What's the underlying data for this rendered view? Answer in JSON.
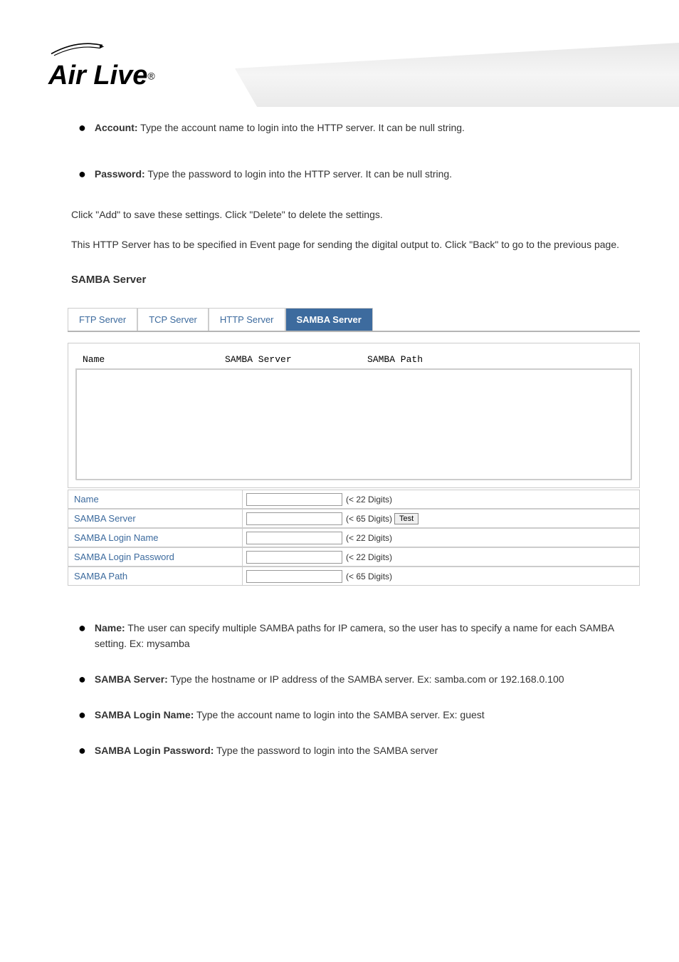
{
  "logo": {
    "brand": "Air Live",
    "registered": "®"
  },
  "top_bullets": [
    {
      "label": "Account:",
      "text": " Type the account name to login into the HTTP server. It can be null string."
    },
    {
      "label": "Password:",
      "text": " Type the password to login into the HTTP server. It can be null string."
    }
  ],
  "post_note": "Click \"Add\" to save these settings. Click \"Delete\" to delete the settings.",
  "subtitle": "This HTTP Server has to be specified in Event page for sending the digital output to. Click \"Back\" to go to the previous page.",
  "samba_title": "SAMBA Server",
  "tabs": {
    "ftp": "FTP Server",
    "tcp": "TCP Server",
    "http": "HTTP Server",
    "samba": "SAMBA Server"
  },
  "list_header": {
    "c1": "Name",
    "c2": "SAMBA Server",
    "c3": "SAMBA Path"
  },
  "form": {
    "name": {
      "label": "Name",
      "hint": "(< 22 Digits)"
    },
    "server": {
      "label": "SAMBA Server",
      "hint": "(< 65 Digits)",
      "test": "Test"
    },
    "login": {
      "label": "SAMBA Login Name",
      "hint": "(< 22 Digits)"
    },
    "password": {
      "label": "SAMBA Login Password",
      "hint": "(< 22 Digits)"
    },
    "path": {
      "label": "SAMBA Path",
      "hint": "(< 65 Digits)"
    }
  },
  "bottom_bullets": [
    {
      "label": "Name:",
      "text": " The user can specify multiple SAMBA paths for IP camera, so the user has to specify a name for each SAMBA setting. Ex: mysamba"
    },
    {
      "label": "SAMBA Server:",
      "text": " Type the hostname or IP address of the SAMBA server. Ex: samba.com or 192.168.0.100"
    },
    {
      "label": "SAMBA Login Name:",
      "text": " Type the account name to login into the SAMBA server. Ex: guest"
    },
    {
      "label": "SAMBA Login Password:",
      "text": " Type the password to login into the SAMBA server"
    }
  ]
}
